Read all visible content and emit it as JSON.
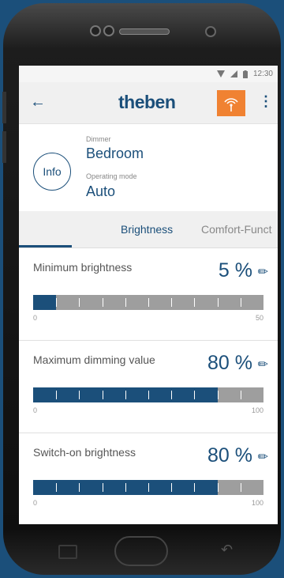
{
  "status": {
    "time": "12:30"
  },
  "appbar": {
    "brand": "theben",
    "back_icon": "arrow-left-icon",
    "action_icon": "signal-broadcast-icon",
    "action_color": "#f08232",
    "menu_icon": "more-vert-icon"
  },
  "device": {
    "info_label": "Info",
    "type_label": "Dimmer",
    "name": "Bedroom",
    "mode_label": "Operating mode",
    "mode_value": "Auto"
  },
  "tabs": [
    {
      "label": "Brightness",
      "active": true
    },
    {
      "label": "Comfort-Funct",
      "active": false
    }
  ],
  "settings": [
    {
      "label": "Minimum brightness",
      "value": "5 %",
      "min": "0",
      "max": "50",
      "level": 0.1
    },
    {
      "label": "Maximum dimming value",
      "value": "80 %",
      "min": "0",
      "max": "100",
      "level": 0.8
    },
    {
      "label": "Switch-on brightness",
      "value": "80 %",
      "min": "0",
      "max": "100",
      "level": 0.8
    }
  ],
  "colors": {
    "accent": "#1b4f7a",
    "track": "#9e9e9e"
  }
}
